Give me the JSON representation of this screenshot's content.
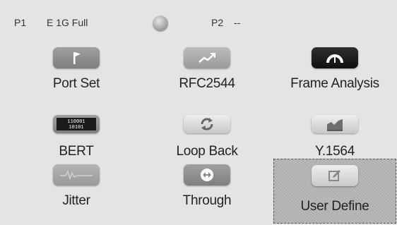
{
  "status": {
    "port1_label": "P1",
    "port1_value": "E 1G Full",
    "port2_label": "P2",
    "port2_value": "--"
  },
  "tiles": [
    {
      "label": "Port Set",
      "icon": "flag-icon"
    },
    {
      "label": "RFC2544",
      "icon": "trend-chart-icon"
    },
    {
      "label": "Frame Analysis",
      "icon": "gauge-icon"
    },
    {
      "label": "BERT",
      "icon": "binary-counter-icon"
    },
    {
      "label": "Loop Back",
      "icon": "loop-arrows-icon"
    },
    {
      "label": "Y.1564",
      "icon": "area-chart-icon"
    },
    {
      "label": "Jitter",
      "icon": "waveform-icon"
    },
    {
      "label": "Through",
      "icon": "bidirectional-arrow-icon"
    },
    {
      "label": "User Define",
      "icon": "edit-icon"
    }
  ],
  "bert_icon_digits": [
    "110001",
    "10101"
  ],
  "selected_tile": "User Define"
}
